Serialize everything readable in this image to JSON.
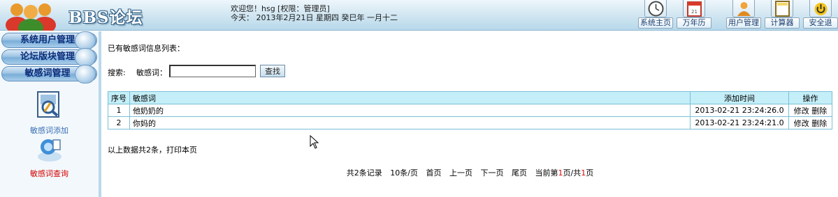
{
  "header": {
    "app_title": "BBS论坛",
    "welcome_line": "欢迎您！hsg [权限：管理员]",
    "date_line": "今天： 2013年2月21日 星期四 癸巳年 一月十二",
    "tools": [
      {
        "icon": "clock-icon",
        "label": "系统主页"
      },
      {
        "icon": "calendar-icon",
        "label": "万年历"
      },
      {
        "icon": "user-icon",
        "label": "用户管理"
      },
      {
        "icon": "calculator-icon",
        "label": "计算器"
      },
      {
        "icon": "power-icon",
        "label": "安全退"
      }
    ]
  },
  "sidebar": {
    "menu": [
      {
        "label": "系统用户管理"
      },
      {
        "label": "论坛版块管理"
      },
      {
        "label": "敏感词管理"
      }
    ],
    "items": [
      {
        "icon": "word-add-icon",
        "label": "敏感词添加"
      },
      {
        "icon": "word-search-icon",
        "label": "敏感词查询"
      }
    ]
  },
  "main": {
    "list_title": "已有敏感词信息列表：",
    "search": {
      "label": "搜索:",
      "field_label": "敏感词：",
      "value": "",
      "button": "查找"
    },
    "table": {
      "headers": [
        "序号",
        "敏感词",
        "添加时间",
        "操作"
      ],
      "rows": [
        {
          "no": "1",
          "word": "他奶奶的",
          "time": "2013-02-21 23:24:26.0",
          "edit": "修改",
          "delete": "删除"
        },
        {
          "no": "2",
          "word": "你妈的",
          "time": "2013-02-21 23:24:21.0",
          "edit": "修改",
          "delete": "删除"
        }
      ]
    },
    "summary": "以上数据共2条，打印本页",
    "pager": {
      "total": "共2条记录",
      "per_page": "10条/页",
      "first": "首页",
      "prev": "上一页",
      "next": "下一页",
      "last": "尾页",
      "current_prefix": "当前第",
      "current_page": "1",
      "current_mid": "页/共",
      "total_pages": "1",
      "current_suffix": "页"
    }
  },
  "colors": {
    "header_bg": "#cfe5f1",
    "table_header_bg": "#c4eef8",
    "table_border": "#7bbfd7",
    "menu_text": "#0c2d7a",
    "side_item_add_color": "#3a6fb5",
    "side_item_query_color": "#d40000",
    "page_highlight": "#e00000"
  }
}
